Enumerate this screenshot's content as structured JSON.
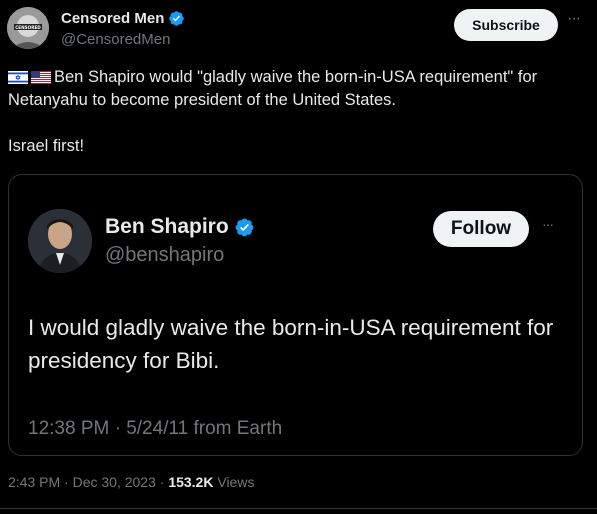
{
  "author": {
    "name": "Censored Men",
    "handle": "@CensoredMen",
    "avatar_text": "CENSORED"
  },
  "subscribe_label": "Subscribe",
  "more_label": "···",
  "tweet": {
    "line1": "Ben Shapiro would \"gladly waive the born-in-USA requirement\" for Netanyahu to become president of the United States.",
    "line2": "Israel first!"
  },
  "quoted": {
    "name": "Ben Shapiro",
    "handle": "@benshapiro",
    "follow_label": "Follow",
    "more_label": "···",
    "text": "I would gladly waive the born-in-USA requirement for presidency for Bibi.",
    "meta": "12:38 PM · 5/24/11 from Earth"
  },
  "meta": {
    "time_date": "2:43 PM · Dec 30, 2023 · ",
    "views_count": "153.2K",
    "views_label": " Views"
  },
  "colors": {
    "background": "#000000",
    "verified": "#1d9bf0",
    "muted": "#71767b",
    "text": "#e7e9ea"
  }
}
